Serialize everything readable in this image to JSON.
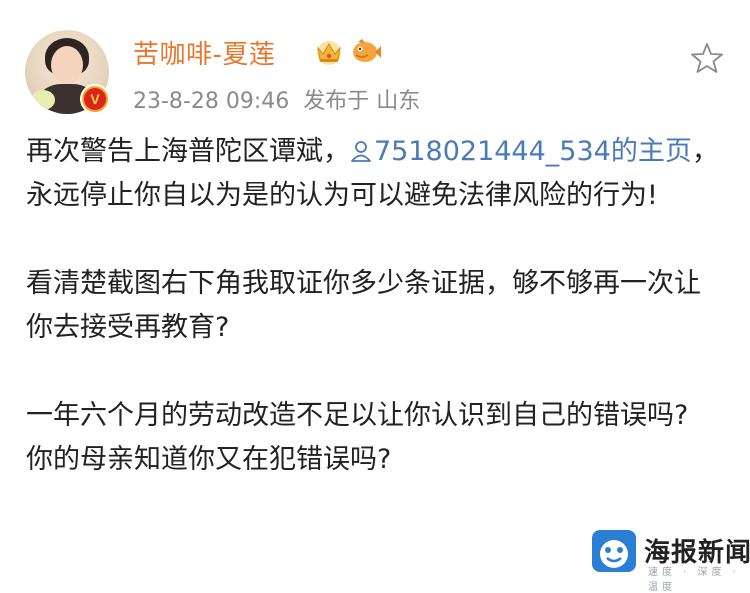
{
  "post": {
    "username": "苦咖啡-夏莲",
    "timestamp": "23-8-28 09:46",
    "source": "发布于 山东",
    "verified_mark": "V",
    "icons": {
      "crown": "crown-icon",
      "fish": "fish-icon",
      "favorite": "star-icon"
    },
    "paragraphs": [
      {
        "before": "再次警告上海普陀区谭斌，",
        "mention": "7518021444_534的主页",
        "after": "，永远停止你自以为是的认为可以避免法律风险的行为!"
      },
      {
        "text": "看清楚截图右下角我取证你多少条证据，够不够再一次让你去接受再教育?"
      },
      {
        "text": "一年六个月的劳动改造不足以让你认识到自己的错误吗?\n你的母亲知道你又在犯错误吗?"
      }
    ]
  },
  "watermark": {
    "title": "海报新闻",
    "tagline": "速度 · 深度 · 温度"
  },
  "colors": {
    "username": "#e8772e",
    "mention": "#4a7ab8",
    "meta": "#8a8a8a",
    "verified_outer": "#f5a623",
    "verified_inner": "#d9261c"
  }
}
